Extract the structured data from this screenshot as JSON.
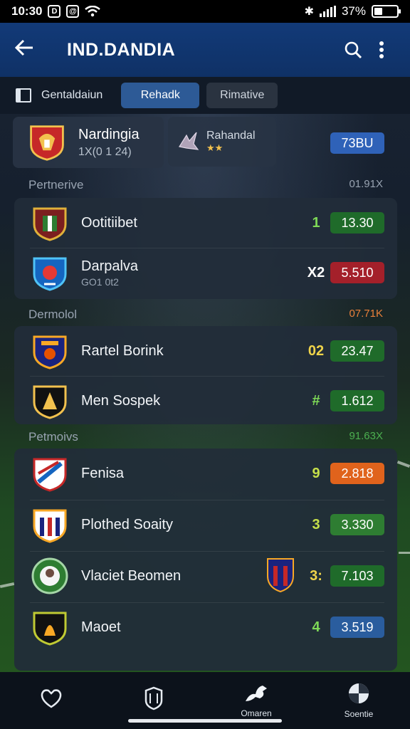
{
  "status_bar": {
    "time": "10:30",
    "battery": "37%",
    "battery_level": 0.37
  },
  "app_bar": {
    "title": "IND.DANDIA"
  },
  "tabs": [
    {
      "label": "Gentaldaiun"
    },
    {
      "label": "Rehadk"
    },
    {
      "label": "Rimative"
    }
  ],
  "featured": {
    "name": "Nardingia",
    "sub": "1X(0 1 24)",
    "secondary_name": "Rahandal",
    "secondary_stars": "★★",
    "odds": "73BU"
  },
  "sections": [
    {
      "title": "Pertnerive",
      "pct": "01.91X",
      "rows": [
        {
          "name": "Ootitiibet",
          "sub": "",
          "rank": "1",
          "rank_color": "#7ed957",
          "odds": "13.30",
          "odds_color": "#1f6b2a"
        },
        {
          "name": "Darpalva",
          "sub": "GO1 0t2",
          "rank": "X2",
          "rank_color": "#ffffff",
          "odds": "5.510",
          "odds_color": "#a4202a"
        }
      ]
    },
    {
      "title": "Dermolol",
      "pct": "07.71K",
      "pct_color": "#e8803a",
      "rows": [
        {
          "name": "Rartel Borink",
          "sub": "",
          "rank": "02",
          "rank_color": "#f0d44a",
          "odds": "23.47",
          "odds_color": "#1f6b2a"
        },
        {
          "name": "Men Sospek",
          "sub": "",
          "rank": "#",
          "rank_color": "#7ed957",
          "odds": "1.612",
          "odds_color": "#1f6b2a"
        }
      ]
    },
    {
      "title": "Petmoivs",
      "pct": "91.63X",
      "pct_color": "#4caf50",
      "rows": [
        {
          "name": "Fenisa",
          "sub": "",
          "rank": "9",
          "rank_color": "#c6e04a",
          "odds": "2.818",
          "odds_color": "#e0631c"
        },
        {
          "name": "Plothed Soaity",
          "sub": "",
          "rank": "3",
          "rank_color": "#c6e04a",
          "odds": "3.330",
          "odds_color": "#2e7d32"
        },
        {
          "name": "Vlaciet Beomen",
          "sub": "",
          "rank": "3:",
          "rank_color": "#f0d44a",
          "odds": "7.103",
          "odds_color": "#1f6b2a"
        },
        {
          "name": "Maoet",
          "sub": "",
          "rank": "4",
          "rank_color": "#7ed957",
          "odds": "3.519",
          "odds_color": "#2a5d9e"
        }
      ]
    }
  ],
  "bottom_nav": [
    {
      "icon": "shield-heart-icon",
      "label": ""
    },
    {
      "icon": "shield-icon",
      "label": ""
    },
    {
      "icon": "dragon-icon",
      "label": "Omaren"
    },
    {
      "icon": "ball-icon",
      "label": "Soentie"
    }
  ]
}
